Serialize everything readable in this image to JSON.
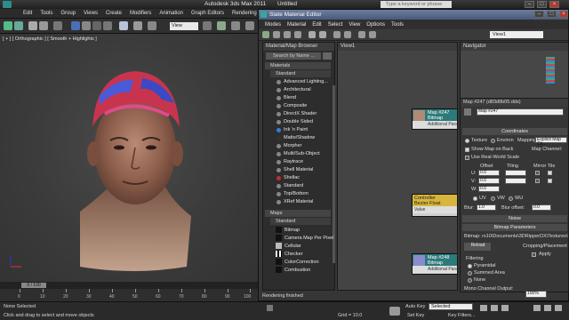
{
  "app": {
    "title": "Autodesk 3ds Max 2011",
    "doc": "Untitled",
    "search_placeholder": "Type a keyword or phrase"
  },
  "main_menu": [
    "Edit",
    "Tools",
    "Group",
    "Views",
    "Create",
    "Modifiers",
    "Animation",
    "Graph Editors",
    "Rendering"
  ],
  "toolbar": {
    "view_dropdown": "View"
  },
  "viewport": {
    "label": "[ + ] [ Orthographic ] [ Smooth + Highlights ]"
  },
  "timeline": {
    "frame": "0 / 100",
    "ticks": [
      "0",
      "10",
      "20",
      "30",
      "40",
      "50",
      "60",
      "70",
      "80",
      "90",
      "100"
    ]
  },
  "status": {
    "line1": "None Selected",
    "line2": "Click and drag to select and move objects",
    "grid": "Grid = 10.0",
    "auto_key": "Auto Key",
    "selected": "Selected",
    "set_key": "Set Key",
    "key_filters": "Key Filters..."
  },
  "sme": {
    "title": "Slate Material Editor",
    "menu": [
      "Modes",
      "Material",
      "Edit",
      "Select",
      "View",
      "Options",
      "Tools"
    ],
    "view_dropdown": "View1",
    "browser": {
      "title": "Material/Map Browser",
      "search": "Search by Name ...",
      "materials_group": "Materials",
      "standard_group": "Standard",
      "materials": [
        "Advanced Lighting...",
        "Architectural",
        "Blend",
        "Composite",
        "DirectX Shader",
        "Double Sided",
        "Ink 'n Paint",
        "Matte/Shadow",
        "Morpher",
        "Multi/Sub-Object",
        "Raytrace",
        "Shell Material",
        "Shellac",
        "Standard",
        "Top/Bottom",
        "XRef Material"
      ],
      "maps_group": "Maps",
      "maps_standard_group": "Standard",
      "maps": [
        "Bitmap",
        "Camera Map Per Pixel",
        "Cellular",
        "Checker",
        "ColorCorrection",
        "Combustion"
      ]
    },
    "view_title": "View1",
    "nodes": [
      {
        "title": "Map #247",
        "subtitle": "Bitmap",
        "port": "Additional Para..."
      },
      {
        "title": "Controller",
        "subtitle": "Bezier Float",
        "port": "Value"
      },
      {
        "title": "Map #248",
        "subtitle": "Bitmap",
        "port": "Additional Para..."
      }
    ],
    "navigator_title": "Navigator",
    "params": {
      "title": "Map #247 (d83d9b05.dds)",
      "map_name": "Map #247",
      "coordinates": "Coordinates",
      "texture": "Texture",
      "environ": "Environ",
      "mapping_label": "Mapping:",
      "mapping_value": "Explicit Map Ch...",
      "show_map_on_back": "Show Map on Back",
      "map_channel": "Map Channel:",
      "use_real_world": "Use Real-World Scale",
      "offset": "Offset",
      "tiling": "Tiling",
      "mirror_tile": "Mirror Tile",
      "u": "U:",
      "v": "V:",
      "w": "W:",
      "u_offset": "0.0",
      "v_offset": "0.0",
      "w_offset": "0.0",
      "uv": "UV",
      "vw": "VW",
      "wu": "WU",
      "blur": "Blur:",
      "blur_value": "1.0",
      "blur_offset": "Blur offset:",
      "blur_offset_value": "0.0",
      "noise": "Noise",
      "bitmap_params": "Bitmap Parameters",
      "bitmap_path": "Bitmap: rs10\\Documents\\3DRipperDX\\Textures\\d83d9b05.dds",
      "reload": "Reload",
      "cropping": "Cropping/Placement",
      "apply": "Apply",
      "filtering": "Filtering",
      "pyramidal": "Pyramidal",
      "summed_area": "Summed Area",
      "none": "None",
      "mono_channel_output": "Mono Channel Output:",
      "zoom": "100%"
    },
    "status": "Rendering finished"
  },
  "colors": {
    "accent_title": "#55678d",
    "node_header": "#2c7a7a",
    "controller_header": "#d8b53c",
    "selected_blue": "#2f6fd6"
  }
}
